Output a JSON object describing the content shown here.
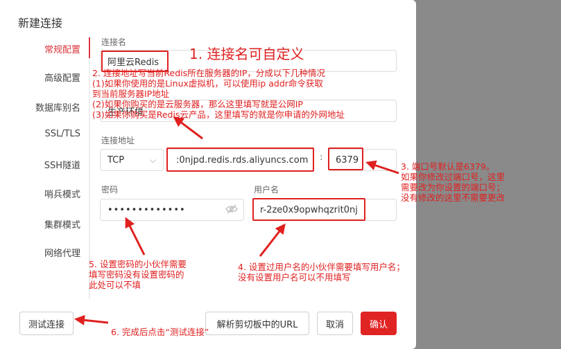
{
  "dialog": {
    "title": "新建连接"
  },
  "sidebar": {
    "items": [
      {
        "label": "常规配置"
      },
      {
        "label": "高级配置"
      },
      {
        "label": "数据库别名"
      },
      {
        "label": "SSL/TLS"
      },
      {
        "label": "SSH隧道"
      },
      {
        "label": "哨兵模式"
      },
      {
        "label": "集群模式"
      },
      {
        "label": "网络代理"
      }
    ]
  },
  "form": {
    "name_label": "连接名",
    "name_value": "阿里云Redis",
    "desc_value": "生产环境",
    "address_label": "连接地址",
    "protocol_value": "TCP",
    "host_value": ":0njpd.redis.rds.aliyuncs.com",
    "colon": ":",
    "port_value": "6379",
    "password_label": "密码",
    "password_value": "•••••••••••••",
    "username_label": "用户名",
    "username_value": "r-2ze0x9opwhqzrit0nj"
  },
  "footer": {
    "test_label": "测试连接",
    "parse_label": "解析剪切板中的URL",
    "cancel_label": "取消",
    "confirm_label": "确认"
  },
  "annotations": {
    "note1": "1. 连接名可自定义",
    "note2": "2. 连接地址写当前Redis所在服务器的IP，分成以下几种情况\n(1)如果你使用的是Linux虚拟机，可以使用ip addr命令获取\n到当前服务器IP地址\n(2)如果你购买的是云服务器，那么这里填写就是公网IP\n(3)如果你购买是Redis云产品，这里填写的就是你申请的外网地址",
    "note3": "3. 端口号默认是6379。\n如果你修改过端口号，这里\n需要改为你设置的端口号；\n没有修改的这里不需要更改",
    "note4": "4. 设置过用户名的小伙伴需要填写用户名；\n没有设置用户名可以不用填写",
    "note5": "5. 设置密码的小伙伴需要\n填写密码没有设置密码的\n此处可以不填",
    "note6": "6. 完成后点击“测试连接”"
  },
  "colors": {
    "accent": "#e02020",
    "background": "#8a8a8a"
  }
}
